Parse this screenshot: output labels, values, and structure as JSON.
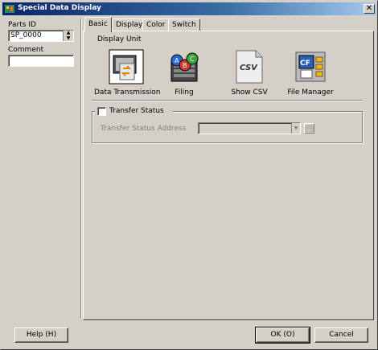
{
  "window": {
    "title": "Special Data Display",
    "close_glyph": "✕"
  },
  "left": {
    "parts_id_label": "Parts ID",
    "parts_id_value": "SP_0000",
    "comment_label": "Comment",
    "comment_value": ""
  },
  "tabs": [
    {
      "label": "Basic",
      "active": true
    },
    {
      "label": "Display",
      "active": false
    },
    {
      "label": "Color",
      "active": false
    },
    {
      "label": "Switch",
      "active": false
    }
  ],
  "basic": {
    "display_unit_label": "Display Unit",
    "units": [
      {
        "label": "Data Transmission",
        "icon": "data-transmission-icon"
      },
      {
        "label": "Filing",
        "icon": "filing-icon"
      },
      {
        "label": "Show CSV",
        "icon": "csv-icon"
      },
      {
        "label": "File Manager",
        "icon": "file-manager-icon"
      }
    ],
    "icon_text": {
      "filing": [
        "A",
        "B",
        "C"
      ],
      "csv": "CSV",
      "file_manager": "CF"
    },
    "transfer_status": {
      "checkbox_label": "Transfer Status",
      "checked": false,
      "address_label": "Transfer Status Address",
      "address_value": ""
    }
  },
  "buttons": {
    "help": "Help (H)",
    "ok": "OK (O)",
    "cancel": "Cancel"
  }
}
